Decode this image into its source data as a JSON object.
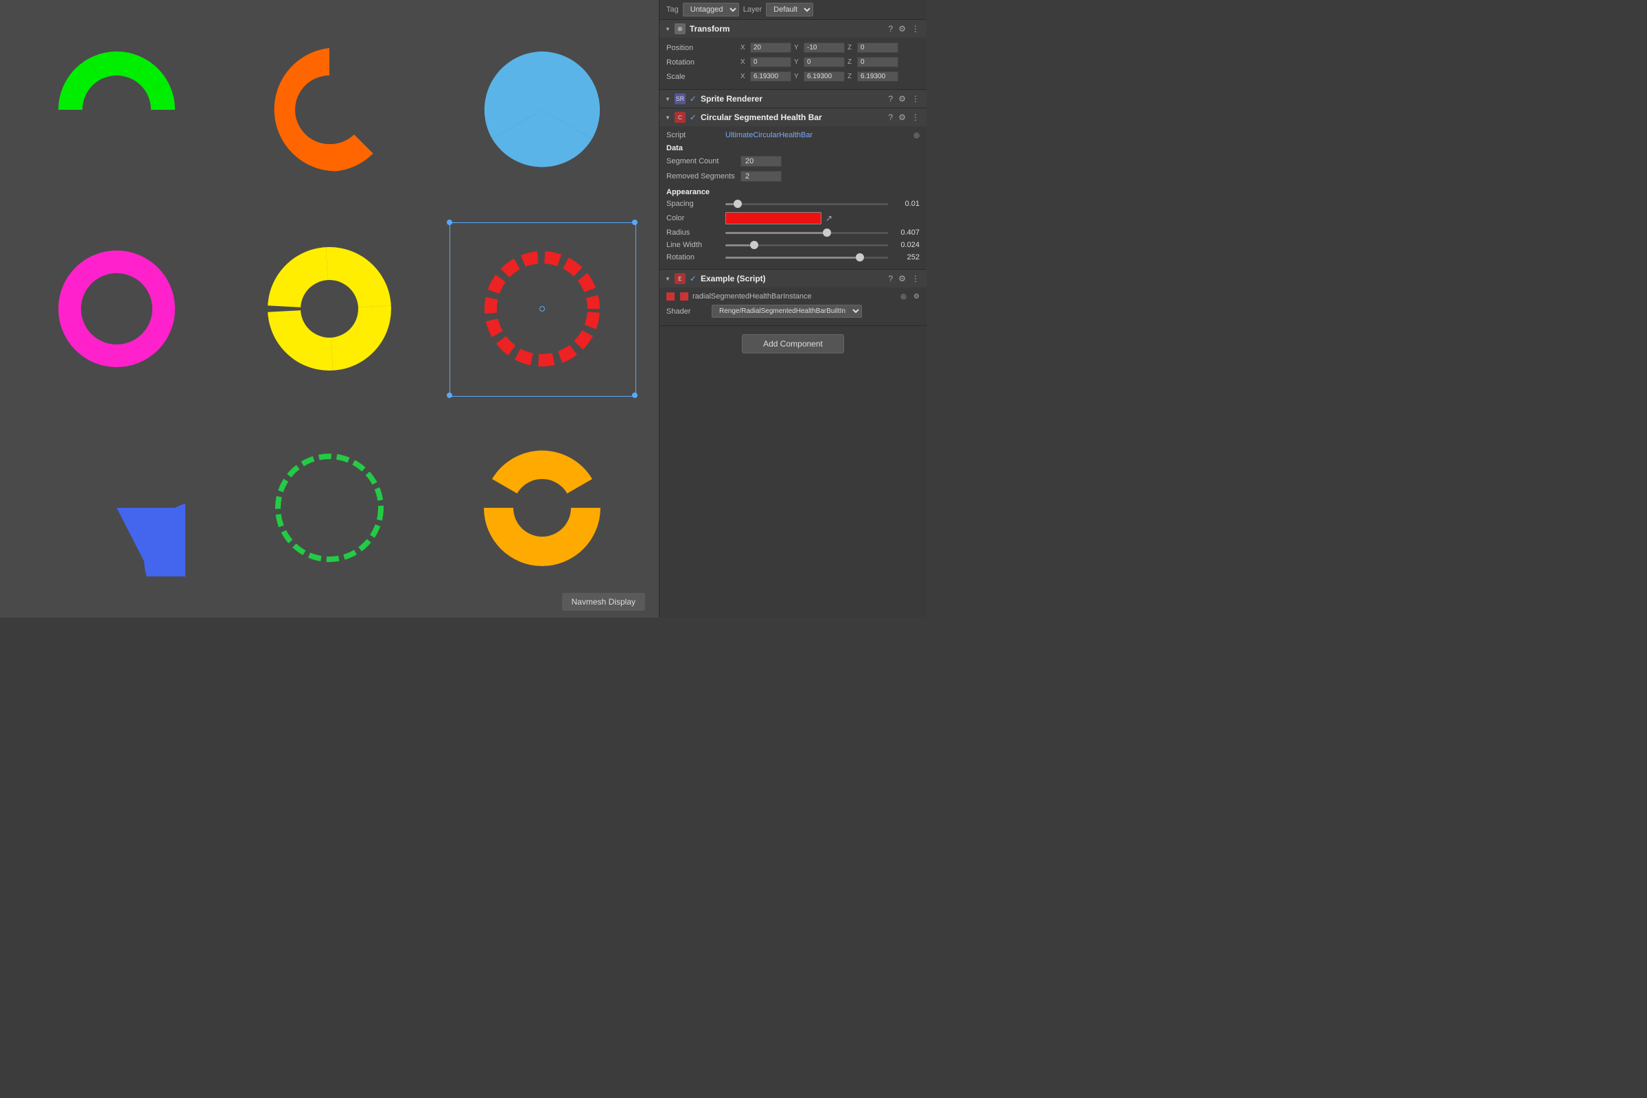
{
  "tag": {
    "label": "Tag",
    "value": "Untagged",
    "layer_label": "Layer",
    "layer_value": "Default"
  },
  "transform": {
    "title": "Transform",
    "position_label": "Position",
    "pos_x": "20",
    "pos_y": "-10",
    "pos_z": "0",
    "rotation_label": "Rotation",
    "rot_x": "0",
    "rot_y": "0",
    "rot_z": "0",
    "scale_label": "Scale",
    "scale_x": "6.19300",
    "scale_y": "6.19300",
    "scale_z": "6.19300"
  },
  "sprite_renderer": {
    "title": "Sprite Renderer"
  },
  "health_bar": {
    "title": "Circular Segmented Health Bar",
    "script_label": "Script",
    "script_value": "UltimateCircularHealthBar",
    "data_label": "Data",
    "segment_count_label": "Segment Count",
    "segment_count_value": "20",
    "removed_segments_label": "Removed Segments",
    "removed_segments_value": "2",
    "appearance_label": "Appearance",
    "spacing_label": "Spacing",
    "spacing_value": "0.01",
    "spacing_pct": 5,
    "color_label": "Color",
    "radius_label": "Radius",
    "radius_value": "0.407",
    "radius_pct": 60,
    "linewidth_label": "Line Width",
    "linewidth_value": "0.024",
    "linewidth_pct": 15,
    "rotation_label": "Rotation",
    "rotation_value": "252",
    "rotation_pct": 80
  },
  "example_script": {
    "title": "Example (Script)",
    "instance_label": "radialSegmentedHealthBarInstance",
    "shader_label": "Shader",
    "shader_value": "Renge/RadialSegmentedHealthBarBuiltIn"
  },
  "buttons": {
    "add_component": "Add Component",
    "navmesh": "Navmesh Display"
  },
  "shapes": [
    {
      "id": "green-arc",
      "desc": "Green segmented arc, open bottom"
    },
    {
      "id": "orange-c",
      "desc": "Orange thick C shape"
    },
    {
      "id": "blue-pie",
      "desc": "Blue pie chart 3 segments"
    },
    {
      "id": "pink-ring",
      "desc": "Pink segmented ring"
    },
    {
      "id": "yellow-ring",
      "desc": "Yellow thick ring 4 segments"
    },
    {
      "id": "red-dashes",
      "desc": "Red dashed circle, selected"
    },
    {
      "id": "blue-pie2",
      "desc": "Blue partial pie"
    },
    {
      "id": "green-thin",
      "desc": "Green thin dashed ring"
    },
    {
      "id": "orange-arc",
      "desc": "Orange/yellow half arc"
    }
  ]
}
